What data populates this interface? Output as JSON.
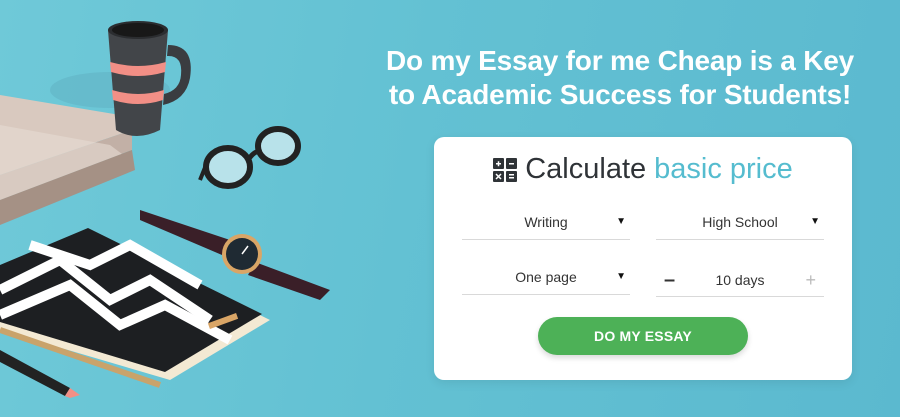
{
  "hero": {
    "headline_line1": "Do my Essay for me Cheap is a Key",
    "headline_line2": "to Academic Success for Students!"
  },
  "calculator": {
    "title_main": "Calculate",
    "title_accent": "basic price",
    "icon": "calculator-icon",
    "paper_type": "Writing",
    "academic_level": "High School",
    "pages": "One page",
    "deadline": "10 days",
    "stepper_minus": "–",
    "stepper_plus": "+",
    "caret": "▼",
    "cta_label": "DO MY ESSAY"
  },
  "colors": {
    "background": "#63c1d3",
    "accent": "#55bccf",
    "cta": "#4db157",
    "card": "#ffffff"
  }
}
